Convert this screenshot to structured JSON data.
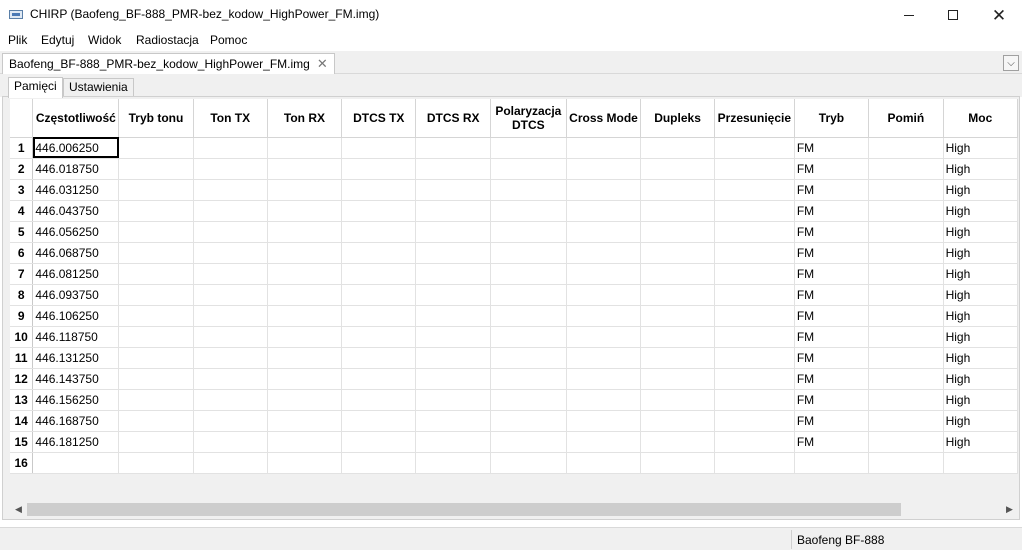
{
  "window": {
    "title": "CHIRP (Baofeng_BF-888_PMR-bez_kodow_HighPower_FM.img)",
    "app_icon": "chirp-app-icon",
    "minimize_icon": "minimize-icon",
    "maximize_icon": "maximize-icon",
    "close_icon": "close-icon",
    "close_glyph": "✕"
  },
  "menu": {
    "items": [
      {
        "label": "Plik"
      },
      {
        "label": "Edytuj"
      },
      {
        "label": "Widok"
      },
      {
        "label": "Radiostacja"
      },
      {
        "label": "Pomoc"
      }
    ]
  },
  "doc_tab": {
    "label": "Baofeng_BF-888_PMR-bez_kodow_HighPower_FM.img",
    "close_glyph": "✕",
    "dropdown_glyph": "⌵"
  },
  "inner_tabs": [
    {
      "label": "Pamięci",
      "active": true
    },
    {
      "label": "Ustawienia",
      "active": false
    }
  ],
  "grid": {
    "columns": [
      {
        "label": "Częstotliwość"
      },
      {
        "label": "Tryb tonu"
      },
      {
        "label": "Ton TX"
      },
      {
        "label": "Ton RX"
      },
      {
        "label": "DTCS TX"
      },
      {
        "label": "DTCS RX"
      },
      {
        "label": "Polaryzacja DTCS"
      },
      {
        "label": "Cross Mode"
      },
      {
        "label": "Dupleks"
      },
      {
        "label": "Przesunięcie"
      },
      {
        "label": "Tryb"
      },
      {
        "label": "Pomiń"
      },
      {
        "label": "Moc"
      }
    ],
    "rows": [
      {
        "num": "1",
        "freq": "446.006250",
        "mode": "FM",
        "power": "High"
      },
      {
        "num": "2",
        "freq": "446.018750",
        "mode": "FM",
        "power": "High"
      },
      {
        "num": "3",
        "freq": "446.031250",
        "mode": "FM",
        "power": "High"
      },
      {
        "num": "4",
        "freq": "446.043750",
        "mode": "FM",
        "power": "High"
      },
      {
        "num": "5",
        "freq": "446.056250",
        "mode": "FM",
        "power": "High"
      },
      {
        "num": "6",
        "freq": "446.068750",
        "mode": "FM",
        "power": "High"
      },
      {
        "num": "7",
        "freq": "446.081250",
        "mode": "FM",
        "power": "High"
      },
      {
        "num": "8",
        "freq": "446.093750",
        "mode": "FM",
        "power": "High"
      },
      {
        "num": "9",
        "freq": "446.106250",
        "mode": "FM",
        "power": "High"
      },
      {
        "num": "10",
        "freq": "446.118750",
        "mode": "FM",
        "power": "High"
      },
      {
        "num": "11",
        "freq": "446.131250",
        "mode": "FM",
        "power": "High"
      },
      {
        "num": "12",
        "freq": "446.143750",
        "mode": "FM",
        "power": "High"
      },
      {
        "num": "13",
        "freq": "446.156250",
        "mode": "FM",
        "power": "High"
      },
      {
        "num": "14",
        "freq": "446.168750",
        "mode": "FM",
        "power": "High"
      },
      {
        "num": "15",
        "freq": "446.181250",
        "mode": "FM",
        "power": "High"
      },
      {
        "num": "16",
        "freq": "",
        "mode": "",
        "power": ""
      }
    ],
    "selected_row": 1
  },
  "scrollbar": {
    "left_glyph": "◀",
    "right_glyph": "▶"
  },
  "status": {
    "radio_model": "Baofeng BF-888"
  }
}
